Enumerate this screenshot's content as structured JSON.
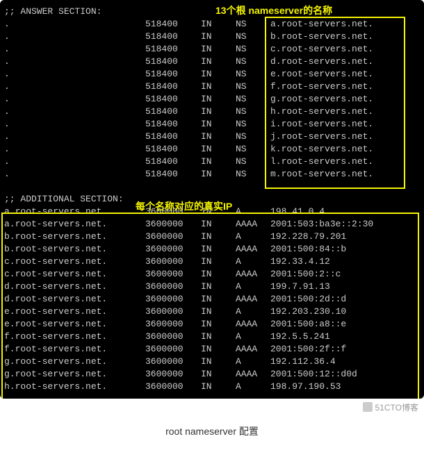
{
  "annotations": {
    "top": "13个根 nameserver的名称",
    "mid": "每个名称对应的真实IP"
  },
  "sections": {
    "answer_header": ";; ANSWER SECTION:",
    "additional_header": ";; ADDITIONAL SECTION:"
  },
  "answer_rows": [
    {
      "name": ".",
      "ttl": "518400",
      "class": "IN",
      "type": "NS",
      "value": "a.root-servers.net."
    },
    {
      "name": ".",
      "ttl": "518400",
      "class": "IN",
      "type": "NS",
      "value": "b.root-servers.net."
    },
    {
      "name": ".",
      "ttl": "518400",
      "class": "IN",
      "type": "NS",
      "value": "c.root-servers.net."
    },
    {
      "name": ".",
      "ttl": "518400",
      "class": "IN",
      "type": "NS",
      "value": "d.root-servers.net."
    },
    {
      "name": ".",
      "ttl": "518400",
      "class": "IN",
      "type": "NS",
      "value": "e.root-servers.net."
    },
    {
      "name": ".",
      "ttl": "518400",
      "class": "IN",
      "type": "NS",
      "value": "f.root-servers.net."
    },
    {
      "name": ".",
      "ttl": "518400",
      "class": "IN",
      "type": "NS",
      "value": "g.root-servers.net."
    },
    {
      "name": ".",
      "ttl": "518400",
      "class": "IN",
      "type": "NS",
      "value": "h.root-servers.net."
    },
    {
      "name": ".",
      "ttl": "518400",
      "class": "IN",
      "type": "NS",
      "value": "i.root-servers.net."
    },
    {
      "name": ".",
      "ttl": "518400",
      "class": "IN",
      "type": "NS",
      "value": "j.root-servers.net."
    },
    {
      "name": ".",
      "ttl": "518400",
      "class": "IN",
      "type": "NS",
      "value": "k.root-servers.net."
    },
    {
      "name": ".",
      "ttl": "518400",
      "class": "IN",
      "type": "NS",
      "value": "l.root-servers.net."
    },
    {
      "name": ".",
      "ttl": "518400",
      "class": "IN",
      "type": "NS",
      "value": "m.root-servers.net."
    }
  ],
  "additional_rows": [
    {
      "name": "a.root-servers.net.",
      "ttl": "3600000",
      "class": "IN",
      "type": "A",
      "value": "198.41.0.4"
    },
    {
      "name": "a.root-servers.net.",
      "ttl": "3600000",
      "class": "IN",
      "type": "AAAA",
      "value": "2001:503:ba3e::2:30"
    },
    {
      "name": "b.root-servers.net.",
      "ttl": "3600000",
      "class": "IN",
      "type": "A",
      "value": "192.228.79.201"
    },
    {
      "name": "b.root-servers.net.",
      "ttl": "3600000",
      "class": "IN",
      "type": "AAAA",
      "value": "2001:500:84::b"
    },
    {
      "name": "c.root-servers.net.",
      "ttl": "3600000",
      "class": "IN",
      "type": "A",
      "value": "192.33.4.12"
    },
    {
      "name": "c.root-servers.net.",
      "ttl": "3600000",
      "class": "IN",
      "type": "AAAA",
      "value": "2001:500:2::c"
    },
    {
      "name": "d.root-servers.net.",
      "ttl": "3600000",
      "class": "IN",
      "type": "A",
      "value": "199.7.91.13"
    },
    {
      "name": "d.root-servers.net.",
      "ttl": "3600000",
      "class": "IN",
      "type": "AAAA",
      "value": "2001:500:2d::d"
    },
    {
      "name": "e.root-servers.net.",
      "ttl": "3600000",
      "class": "IN",
      "type": "A",
      "value": "192.203.230.10"
    },
    {
      "name": "e.root-servers.net.",
      "ttl": "3600000",
      "class": "IN",
      "type": "AAAA",
      "value": "2001:500:a8::e"
    },
    {
      "name": "f.root-servers.net.",
      "ttl": "3600000",
      "class": "IN",
      "type": "A",
      "value": "192.5.5.241"
    },
    {
      "name": "f.root-servers.net.",
      "ttl": "3600000",
      "class": "IN",
      "type": "AAAA",
      "value": "2001:500:2f::f"
    },
    {
      "name": "g.root-servers.net.",
      "ttl": "3600000",
      "class": "IN",
      "type": "A",
      "value": "192.112.36.4"
    },
    {
      "name": "g.root-servers.net.",
      "ttl": "3600000",
      "class": "IN",
      "type": "AAAA",
      "value": "2001:500:12::d0d"
    },
    {
      "name": "h.root-servers.net.",
      "ttl": "3600000",
      "class": "IN",
      "type": "A",
      "value": "198.97.190.53"
    }
  ],
  "watermark": "51CTO博客",
  "caption": "root nameserver 配置"
}
